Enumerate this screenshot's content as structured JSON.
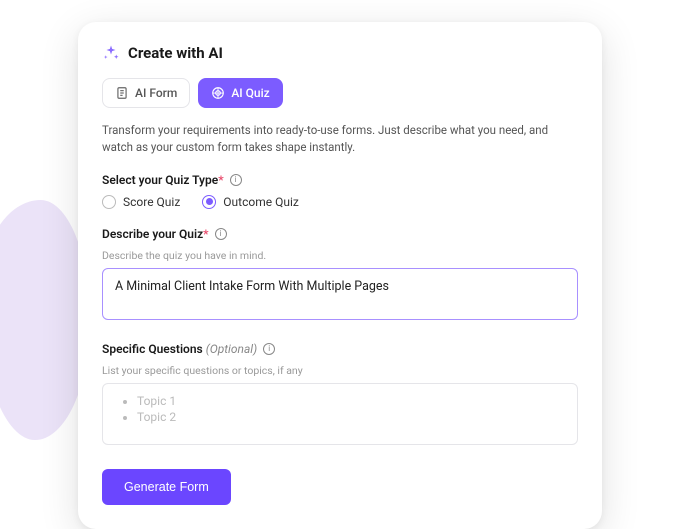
{
  "header": {
    "title": "Create with AI"
  },
  "tabs": {
    "form": "AI Form",
    "quiz": "AI Quiz"
  },
  "description": "Transform your requirements into ready-to-use forms. Just describe what you need, and watch as your custom form takes shape instantly.",
  "quizType": {
    "label": "Select your Quiz Type",
    "options": {
      "score": "Score Quiz",
      "outcome": "Outcome Quiz"
    }
  },
  "describe": {
    "label": "Describe your Quiz",
    "helper": "Describe the quiz you have in mind.",
    "value": "A Minimal Client Intake Form With Multiple Pages"
  },
  "specific": {
    "label": "Specific Questions",
    "optional": "(Optional)",
    "helper": "List your specific questions or topics, if any",
    "placeholder1": "Topic 1",
    "placeholder2": "Topic 2"
  },
  "button": {
    "generate": "Generate Form"
  }
}
